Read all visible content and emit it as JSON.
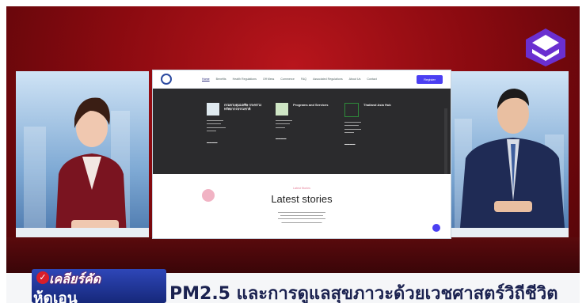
{
  "monitor": {
    "nav": {
      "links": [
        "Home",
        "Benefits",
        "Health Regulations",
        "Off Mess",
        "Commerce",
        "FAQ",
        "Associated Regulations",
        "About Us",
        "Contact"
      ],
      "button": "Register"
    },
    "cards": [
      {
        "title": "กรมควบคุมมลพิษ กระทรวงทรัพยากรธรรมชาติ"
      },
      {
        "title": "Programs and Services"
      },
      {
        "title": "Thailand Asia Hub"
      }
    ],
    "stories_kicker": "Latest Stories",
    "stories_title": "Latest stories"
  },
  "lower_third": {
    "show_name": "เคลียร์คัด",
    "title": "PM2.5 และการดูแลสุขภาวะด้วยเวชศาสตร์วิถีชีวิต"
  },
  "colors": {
    "studio_red": "#8a0a10",
    "accent_blue": "#4b3ff2",
    "title_navy": "#1b2250"
  }
}
